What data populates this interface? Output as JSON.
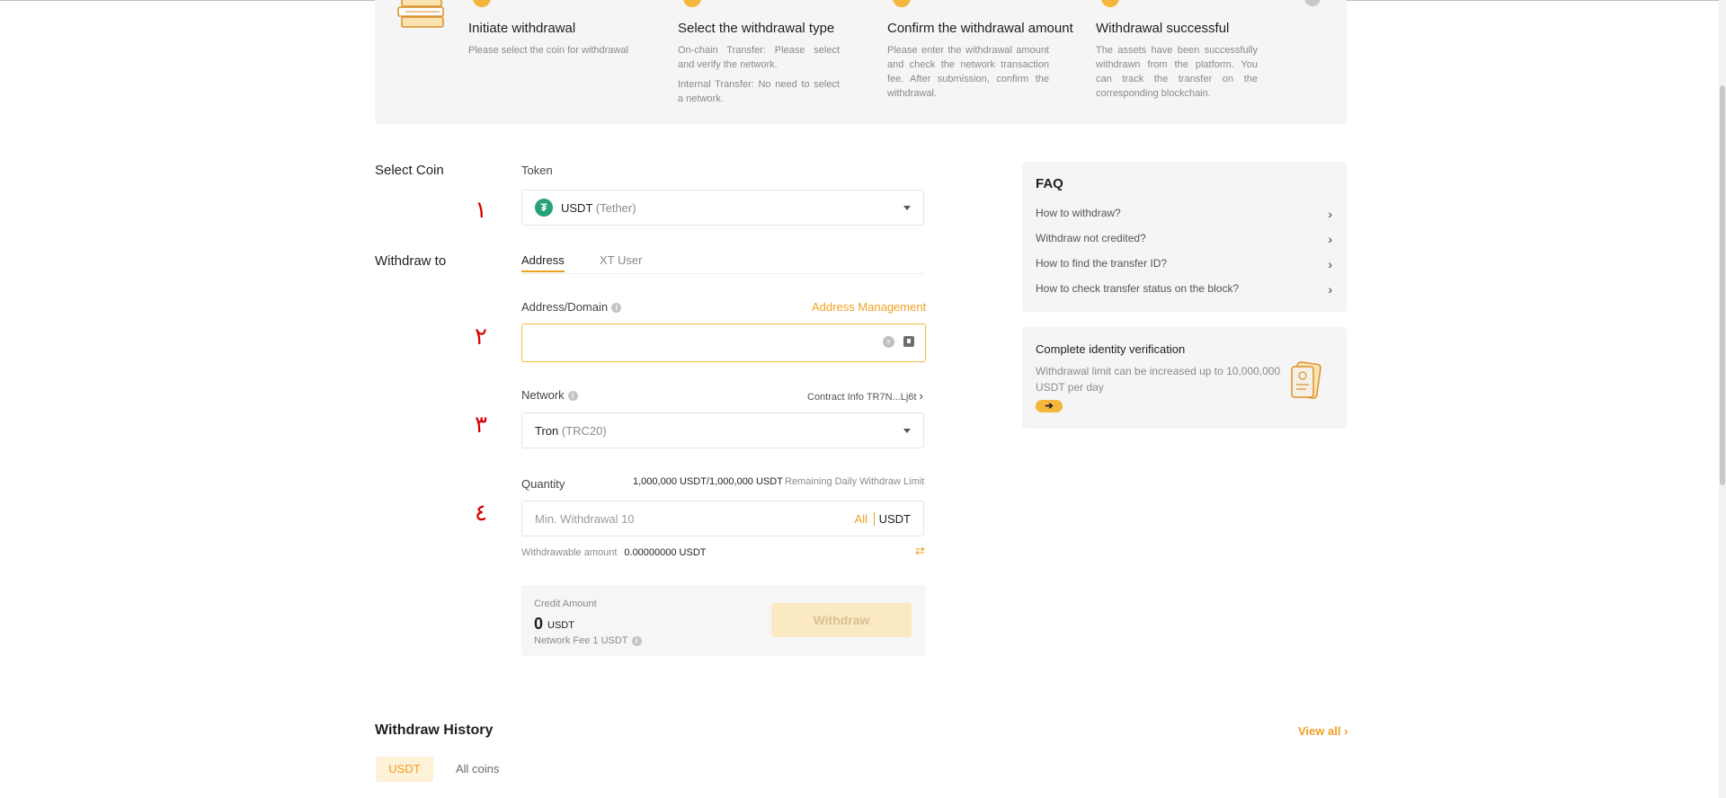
{
  "steps": [
    {
      "title": "Initiate withdrawal",
      "desc": [
        "Please select the coin for withdrawal"
      ]
    },
    {
      "title": "Select the withdrawal type",
      "desc": [
        "On-chain Transfer: Please select and verify the network.",
        "Internal Transfer: No need to select a network."
      ]
    },
    {
      "title": "Confirm the withdrawal amount",
      "desc": [
        "Please enter the withdrawal amount and check the network transaction fee. After submission, confirm the withdrawal."
      ]
    },
    {
      "title": "Withdrawal successful",
      "desc": [
        "The assets have been successfully withdrawn from the platform. You can track the transfer on the corresponding blockchain."
      ]
    }
  ],
  "markers": [
    "١",
    "٢",
    "٣",
    "٤"
  ],
  "select_coin": {
    "section_label": "Select Coin",
    "field_label": "Token",
    "coin_symbol": "USDT",
    "coin_name": "(Tether)"
  },
  "withdraw_to": {
    "section_label": "Withdraw to",
    "tabs": [
      "Address",
      "XT User"
    ],
    "address_label": "Address/Domain",
    "address_management": "Address Management",
    "address_value": ""
  },
  "network": {
    "label": "Network",
    "contract_info": "Contract Info TR7N...Lj6t",
    "selected": "Tron",
    "selected_sub": "(TRC20)"
  },
  "quantity": {
    "label": "Quantity",
    "limit_value": "1,000,000 USDT/1,000,000 USDT",
    "limit_label": "Remaining Daily Withdraw Limit",
    "placeholder": "Min. Withdrawal 10",
    "all_label": "All",
    "unit": "USDT",
    "withdrawable_label": "Withdrawable amount",
    "withdrawable_value": "0.00000000 USDT"
  },
  "credit": {
    "label": "Credit Amount",
    "amount": "0",
    "unit": "USDT",
    "fee": "Network Fee 1 USDT",
    "button": "Withdraw"
  },
  "history": {
    "title": "Withdraw History",
    "view_all": "View all",
    "tabs": [
      "USDT",
      "All coins"
    ]
  },
  "faq": {
    "title": "FAQ",
    "items": [
      "How to withdraw?",
      "Withdraw not credited?",
      "How to find the transfer ID?",
      "How to check transfer status on the block?"
    ]
  },
  "verify": {
    "title": "Complete identity verification",
    "desc": "Withdrawal limit can be increased up to 10,000,000 USDT per day"
  },
  "icons": {
    "coin": "tether-icon",
    "info": "info-icon",
    "chevron": "chevron-right-icon",
    "swap": "swap-icon",
    "clear": "clear-icon",
    "paste": "paste-icon",
    "arrow": "arrow-right-icon"
  },
  "colors": {
    "accent": "#f0a020",
    "marker": "#d60000",
    "tether": "#26a17b",
    "button_disabled_bg": "#fbe9c4"
  }
}
